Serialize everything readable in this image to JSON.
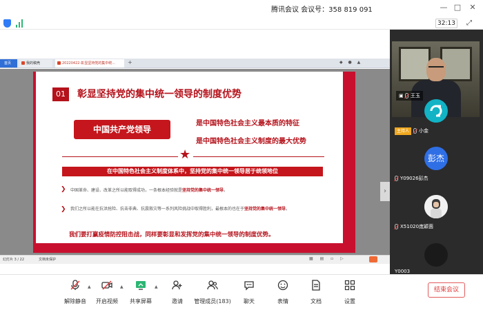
{
  "window": {
    "title": "腾讯会议 会议号：358 819 091",
    "timer": "32:13"
  },
  "browser": {
    "tabs": [
      "首页",
      "我的稿壳",
      "20220422-彰显坚持党的集中统..."
    ]
  },
  "slide": {
    "number": "01",
    "title": "彰显坚持党的集中统一领导的制度优势",
    "red_button": "中国共产党领导",
    "line1": "是中国特色社会主义最本质的特征",
    "line2": "是中国特色社会主义制度的最大优势",
    "banner": "在中国特色社会主义制度体系中，坚持党的集中统一领导居于统领地位",
    "bullet1_text": "中国革命、建设、改革之所以能取得成功，一条根本经验就是",
    "bullet1_highlight": "坚持党的集中统一领导",
    "bullet1_end": "。",
    "bullet2_text": "我们之所以能在抗洪抢险、抗击非典、抗震救灾等一系列风险挑战中取得胜利，最根本的也在于",
    "bullet2_highlight": "坚持党的集中统一领导",
    "bullet2_end": "。",
    "closing": "我们要打赢疫情防控阻击战，同样要彰显和发挥党的集中统一领导的制度优势。"
  },
  "ppt_status": {
    "slide_no": "幻灯片 3 / 22",
    "notes": "文档未保护"
  },
  "participants": [
    {
      "name": "王玉",
      "type": "video"
    },
    {
      "name": "小金",
      "host": "主持人",
      "avatar": "teal"
    },
    {
      "name": "Y09026彭杰",
      "avatar_text": "彭杰",
      "avatar": "blue"
    },
    {
      "name": "X51020庞颖茵",
      "avatar": "photo"
    },
    {
      "name": "Y0003",
      "avatar": "dark"
    }
  ],
  "toolbar": {
    "unmute": "解除静音",
    "video": "开启视频",
    "share": "共享屏幕",
    "invite": "邀请",
    "members": "管理成员(183)",
    "chat": "聊天",
    "emoji": "表情",
    "docs": "文档",
    "settings": "设置",
    "end": "结束会议"
  },
  "colors": {
    "brand_red": "#c4161c",
    "panel_bg": "#2b2b2b",
    "host_badge": "#f0a820",
    "end_red": "#e03b3b"
  }
}
